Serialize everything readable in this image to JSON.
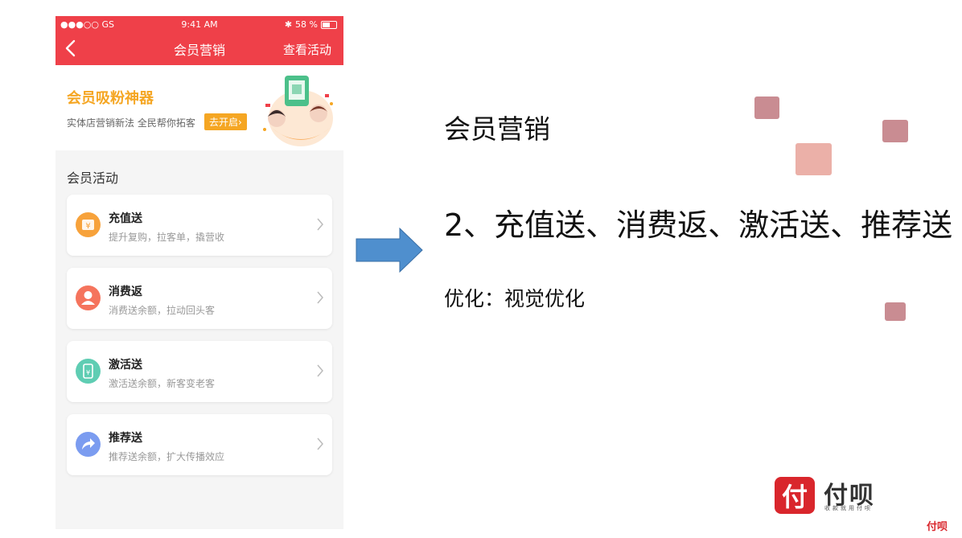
{
  "phone": {
    "status": {
      "carrier": "●●●○○ GS",
      "time": "9:41 AM",
      "battery": "58 %",
      "battery_level": 0.58
    },
    "nav": {
      "title": "会员营销",
      "right_action": "查看活动",
      "back_icon": "chevron-left-icon"
    },
    "banner": {
      "title": "会员吸粉神器",
      "subtitle": "实体店营销新法 全民帮你拓客",
      "button": "去开启›"
    },
    "section_title": "会员活动",
    "cards": [
      {
        "title": "充值送",
        "desc": "提升复购，拉客单，撬营收",
        "icon": "gift-icon",
        "color": "#f7a23b",
        "glyph": "¥"
      },
      {
        "title": "消费返",
        "desc": "消费送余额，拉动回头客",
        "icon": "user-icon",
        "color": "#f5745d",
        "glyph": "●"
      },
      {
        "title": "激活送",
        "desc": "激活送余额，新客变老客",
        "icon": "phone-yen-icon",
        "color": "#5fcdb3",
        "glyph": "¥"
      },
      {
        "title": "推荐送",
        "desc": "推荐送余额，扩大传播效应",
        "icon": "share-icon",
        "color": "#7b9cf0",
        "glyph": "➦"
      }
    ]
  },
  "slide": {
    "heading": "会员营销",
    "line2": "2、充值送、消费返、激活送、推荐送",
    "line3": "优化：视觉优化"
  },
  "brand": {
    "logo_glyph": "付",
    "name": "付呗",
    "tagline": "收款就用付呗",
    "corner_mark": "付呗",
    "accent": "#d9262c"
  },
  "colors": {
    "nav_red": "#ef4049",
    "banner_orange": "#f5a623",
    "arrow_blue": "#4f8fce",
    "square_pink": "#c98c92"
  }
}
